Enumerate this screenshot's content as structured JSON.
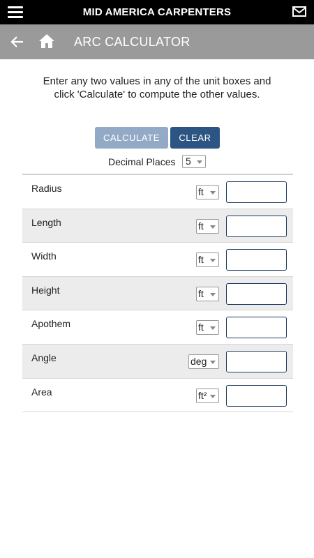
{
  "header": {
    "app_title": "MID AMERICA CARPENTERS",
    "menu_icon": "hamburger-menu-icon",
    "mail_icon": "envelope-icon"
  },
  "nav": {
    "page_title": "ARC CALCULATOR",
    "back_icon": "back-arrow-icon",
    "home_icon": "home-icon"
  },
  "instructions": "Enter any two values in any of the unit boxes and click 'Calculate' to compute the other values.",
  "buttons": {
    "calculate": "CALCULATE",
    "clear": "CLEAR"
  },
  "decimal_places": {
    "label": "Decimal Places",
    "value": "5"
  },
  "fields": [
    {
      "label": "Radius",
      "unit": "ft",
      "value": ""
    },
    {
      "label": "Length",
      "unit": "ft",
      "value": ""
    },
    {
      "label": "Width",
      "unit": "ft",
      "value": ""
    },
    {
      "label": "Height",
      "unit": "ft",
      "value": ""
    },
    {
      "label": "Apothem",
      "unit": "ft",
      "value": ""
    },
    {
      "label": "Angle",
      "unit": "deg",
      "value": ""
    },
    {
      "label": "Area",
      "unit": "ft²",
      "value": ""
    }
  ],
  "colors": {
    "topbar": "#000000",
    "navbar": "#9a9a9a",
    "calculate_button": "#93aac6",
    "clear_button": "#2c5583",
    "alt_row": "#ececec"
  }
}
